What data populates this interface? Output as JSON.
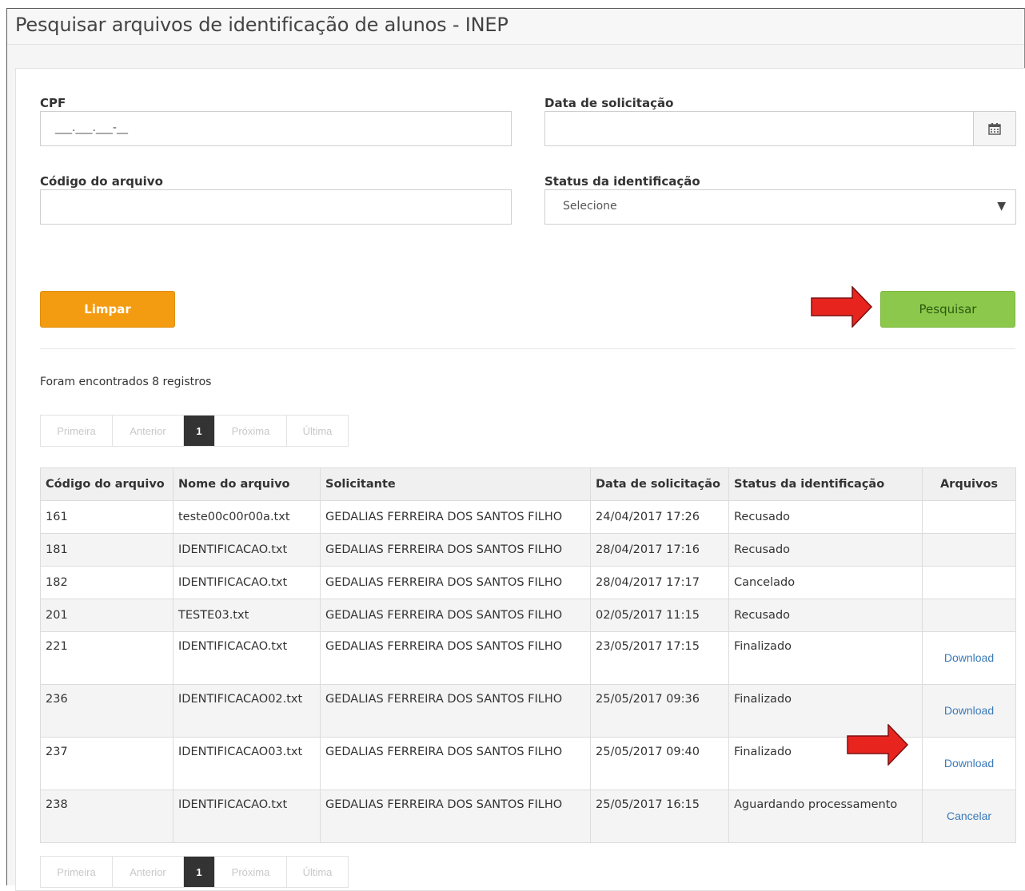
{
  "page": {
    "title": "Pesquisar arquivos de identificação de alunos - INEP"
  },
  "form": {
    "cpf_label": "CPF",
    "cpf_value": "___.___.___-__",
    "date_label": "Data de solicitação",
    "date_value": "",
    "code_label": "Código do arquivo",
    "code_value": "",
    "status_label": "Status da identificação",
    "status_selected": "Selecione"
  },
  "buttons": {
    "clear": "Limpar",
    "search": "Pesquisar"
  },
  "results": {
    "count_text": "Foram encontrados 8 registros"
  },
  "pager": {
    "first": "Primeira",
    "prev": "Anterior",
    "current": "1",
    "next": "Próxima",
    "last": "Última"
  },
  "table": {
    "headers": [
      "Código do arquivo",
      "Nome do arquivo",
      "Solicitante",
      "Data de solicitação",
      "Status da identificação",
      "Arquivos"
    ],
    "rows": [
      {
        "code": "161",
        "name": "teste00c00r00a.txt",
        "requester": "GEDALIAS FERREIRA DOS SANTOS FILHO",
        "date": "24/04/2017 17:26",
        "status": "Recusado",
        "action": ""
      },
      {
        "code": "181",
        "name": "IDENTIFICACAO.txt",
        "requester": "GEDALIAS FERREIRA DOS SANTOS FILHO",
        "date": "28/04/2017 17:16",
        "status": "Recusado",
        "action": ""
      },
      {
        "code": "182",
        "name": "IDENTIFICACAO.txt",
        "requester": "GEDALIAS FERREIRA DOS SANTOS FILHO",
        "date": "28/04/2017 17:17",
        "status": "Cancelado",
        "action": ""
      },
      {
        "code": "201",
        "name": "TESTE03.txt",
        "requester": "GEDALIAS FERREIRA DOS SANTOS FILHO",
        "date": "02/05/2017 11:15",
        "status": "Recusado",
        "action": ""
      },
      {
        "code": "221",
        "name": "IDENTIFICACAO.txt",
        "requester": "GEDALIAS FERREIRA DOS SANTOS FILHO",
        "date": "23/05/2017 17:15",
        "status": "Finalizado",
        "action": "Download"
      },
      {
        "code": "236",
        "name": "IDENTIFICACAO02.txt",
        "requester": "GEDALIAS FERREIRA DOS SANTOS FILHO",
        "date": "25/05/2017 09:36",
        "status": "Finalizado",
        "action": "Download"
      },
      {
        "code": "237",
        "name": "IDENTIFICACAO03.txt",
        "requester": "GEDALIAS FERREIRA DOS SANTOS FILHO",
        "date": "25/05/2017 09:40",
        "status": "Finalizado",
        "action": "Download"
      },
      {
        "code": "238",
        "name": "IDENTIFICACAO.txt",
        "requester": "GEDALIAS FERREIRA DOS SANTOS FILHO",
        "date": "25/05/2017 16:15",
        "status": "Aguardando processamento",
        "action": "Cancelar"
      }
    ]
  },
  "colors": {
    "clear_button": "#f39c12",
    "search_button": "#8cc84b",
    "link": "#3a7ab8",
    "annotation_arrow": "#e8241f"
  }
}
